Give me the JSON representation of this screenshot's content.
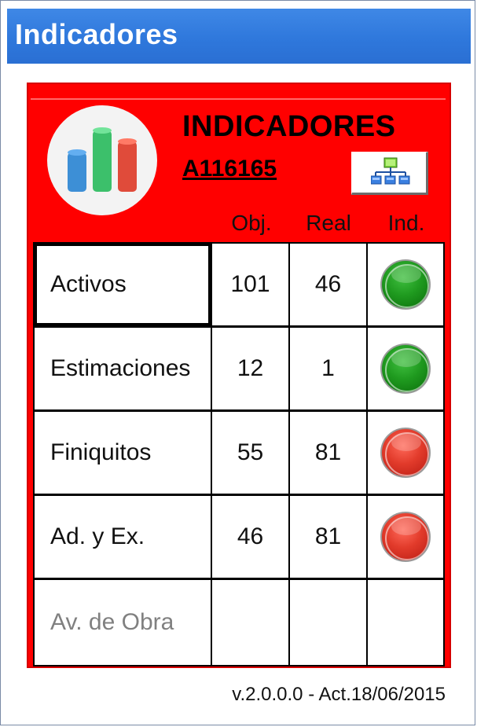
{
  "window": {
    "title": "Indicadores"
  },
  "panel": {
    "heading": "INDICADORES",
    "code": "A116165",
    "org_button_icon": "org-chart-icon",
    "logo_icon": "bar-chart-icon",
    "colors": {
      "panel_bg": "#ff0000",
      "status_green": "#1f9a1f",
      "status_red": "#e23b2b",
      "titlebar": "#2f78dc"
    }
  },
  "table": {
    "columns": [
      "Obj.",
      "Real",
      "Ind."
    ],
    "rows": [
      {
        "label": "Activos",
        "obj": "101",
        "real": "46",
        "status": "green"
      },
      {
        "label": "Estimaciones",
        "obj": "12",
        "real": "1",
        "status": "green"
      },
      {
        "label": "Finiquitos",
        "obj": "55",
        "real": "81",
        "status": "red"
      },
      {
        "label": "Ad. y Ex.",
        "obj": "46",
        "real": "81",
        "status": "red"
      },
      {
        "label": "Av. de Obra",
        "obj": "",
        "real": "",
        "status": ""
      }
    ]
  },
  "footer": {
    "version": "v.2.0.0.0 - Act.18/06/2015"
  }
}
